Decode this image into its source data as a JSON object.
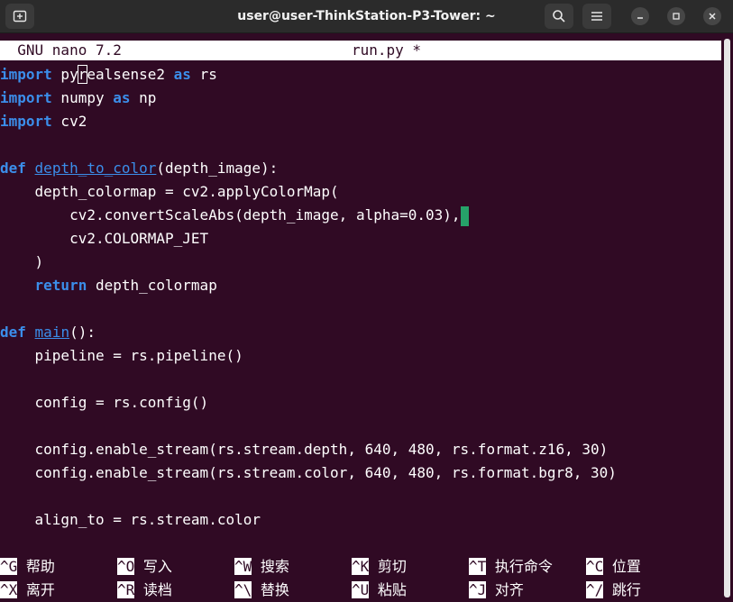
{
  "window": {
    "title": "user@user-ThinkStation-P3-Tower: ~",
    "new_tab_icon": "new-tab-icon",
    "search_icon": "search-icon",
    "menu_icon": "hamburger-menu-icon",
    "minimize_icon": "minimize-icon",
    "maximize_icon": "maximize-icon",
    "close_icon": "close-icon"
  },
  "nano": {
    "version": "  GNU nano 7.2",
    "filename": "run.py *"
  },
  "code": {
    "l1_kw": "import",
    "l1_a": " py",
    "l1_cur": "r",
    "l1_b": "ealsense2 ",
    "l1_kw2": "as",
    "l1_c": " rs",
    "l2_kw": "import",
    "l2_a": " numpy ",
    "l2_kw2": "as",
    "l2_c": " np",
    "l3_kw": "import",
    "l3_a": " cv2",
    "l5_kw": "def",
    "l5_fn": "depth_to_color",
    "l5_rest": "(depth_image):",
    "l6": "    depth_colormap = cv2.applyColorMap(",
    "l7": "        cv2.convertScaleAbs(depth_image, alpha=0.03),",
    "l8": "        cv2.COLORMAP_JET",
    "l9": "    )",
    "l10_kw": "return",
    "l10_rest": " depth_colormap",
    "l12_kw": "def",
    "l12_fn": "main",
    "l12_rest": "():",
    "l13": "    pipeline = rs.pipeline()",
    "l15": "    config = rs.config()",
    "l17": "    config.enable_stream(rs.stream.depth, 640, 480, rs.format.z16, 30)",
    "l18": "    config.enable_stream(rs.stream.color, 640, 480, rs.format.bgr8, 30)",
    "l20": "    align_to = rs.stream.color"
  },
  "shortcuts": [
    {
      "key": "^G",
      "label": " 帮助"
    },
    {
      "key": "^O",
      "label": " 写入"
    },
    {
      "key": "^W",
      "label": " 搜索"
    },
    {
      "key": "^K",
      "label": " 剪切"
    },
    {
      "key": "^T",
      "label": " 执行命令"
    },
    {
      "key": "^C",
      "label": " 位置"
    },
    {
      "key": "^X",
      "label": " 离开"
    },
    {
      "key": "^R",
      "label": " 读档"
    },
    {
      "key": "^\\",
      "label": " 替换"
    },
    {
      "key": "^U",
      "label": " 粘贴"
    },
    {
      "key": "^J",
      "label": " 对齐"
    },
    {
      "key": "^/",
      "label": " 跳行"
    }
  ]
}
